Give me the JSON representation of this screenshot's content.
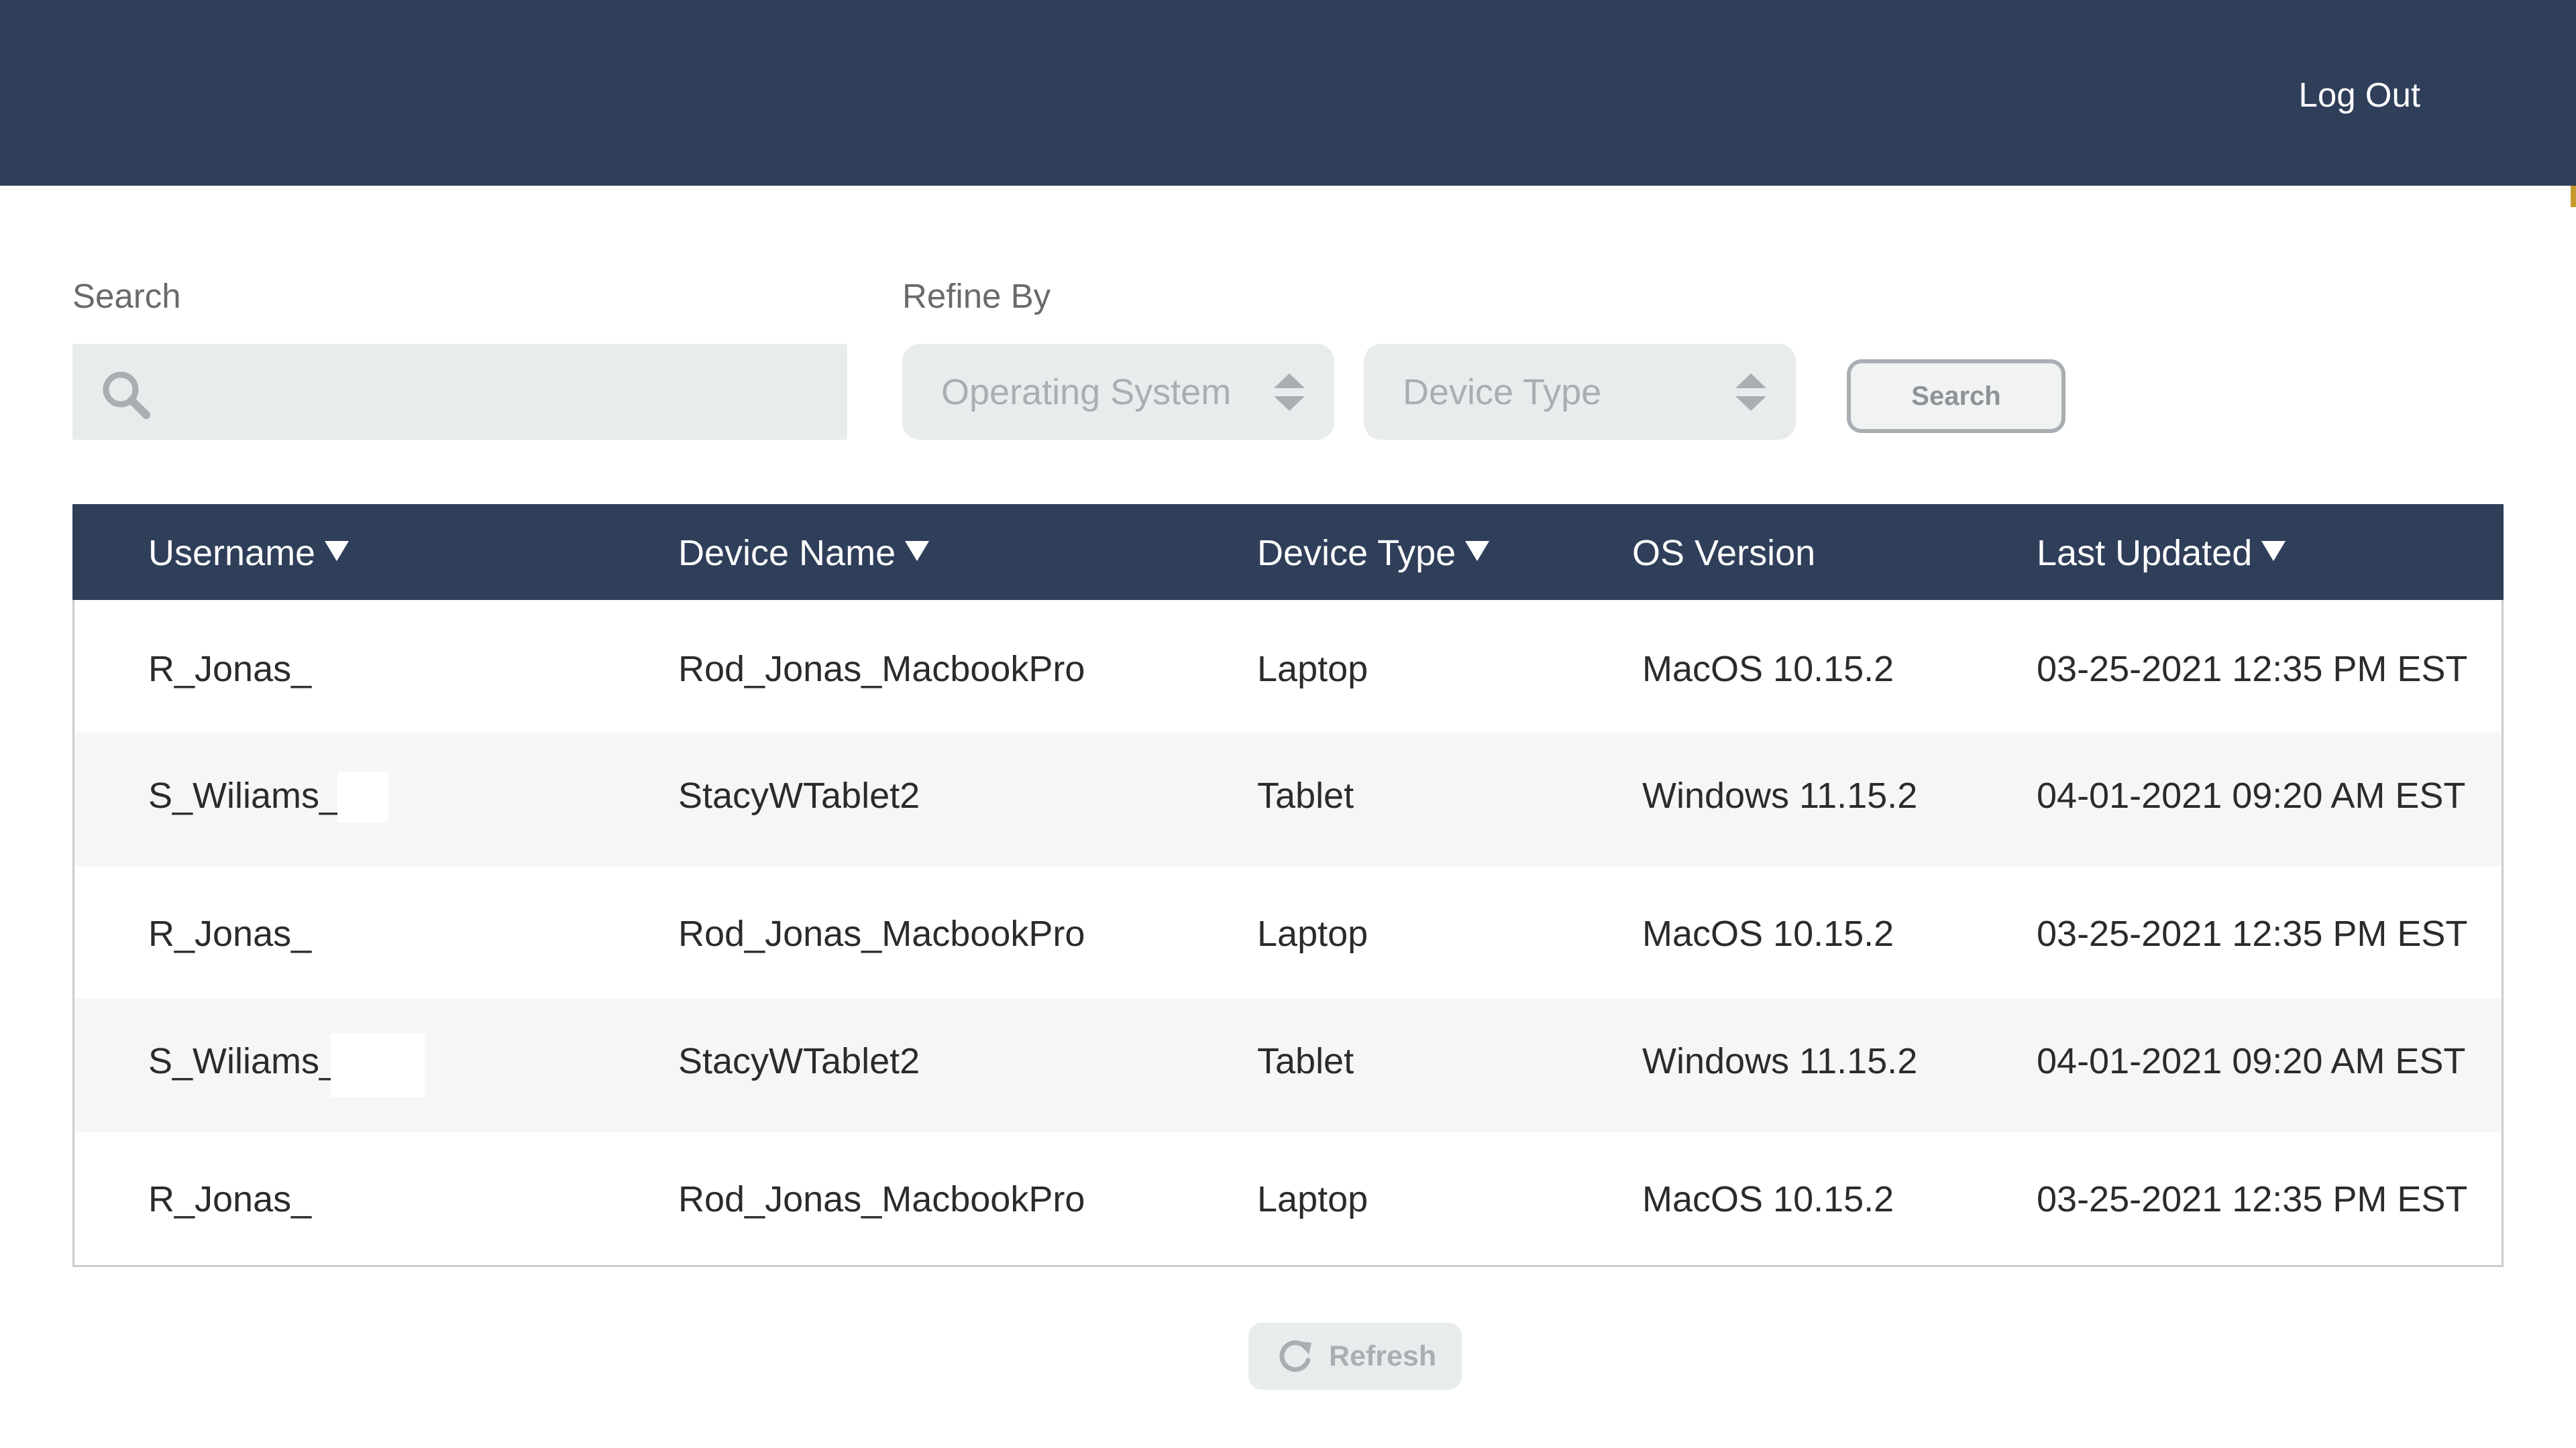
{
  "header": {
    "logout_label": "Log Out",
    "background_color": "#2f3e59"
  },
  "search": {
    "label": "Search",
    "value": "",
    "placeholder": "",
    "icon": "search-icon"
  },
  "refine": {
    "label": "Refine By",
    "os_select": {
      "selected": "Operating System",
      "icon": "sort-arrows-icon"
    },
    "device_select": {
      "selected": "Device Type",
      "icon": "sort-arrows-icon"
    }
  },
  "search_button_label": "Search",
  "table": {
    "columns": [
      {
        "label": "Username",
        "sortable": true
      },
      {
        "label": "Device Name",
        "sortable": true
      },
      {
        "label": "Device Type",
        "sortable": true
      },
      {
        "label": "OS Version",
        "sortable": false
      },
      {
        "label": "Last Updated",
        "sortable": true
      }
    ],
    "rows": [
      [
        "R_Jonas_",
        "Rod_Jonas_MacbookPro",
        "Laptop",
        "MacOS 10.15.2",
        "03-25-2021 12:35 PM EST"
      ],
      [
        "S_Wiliams_\\",
        "StacyWTablet2",
        "Tablet",
        "Windows 11.15.2",
        "04-01-2021 09:20 AM EST"
      ],
      [
        "R_Jonas_",
        "Rod_Jonas_MacbookPro",
        "Laptop",
        "MacOS 10.15.2",
        "03-25-2021 12:35 PM EST"
      ],
      [
        "S_Wiliams_",
        "StacyWTablet2",
        "Tablet",
        "Windows 11.15.2",
        "04-01-2021 09:20 AM EST"
      ],
      [
        "R_Jonas_",
        "Rod_Jonas_MacbookPro",
        "Laptop",
        "MacOS 10.15.2",
        "03-25-2021 12:35 PM EST"
      ]
    ]
  },
  "refresh_button": {
    "label": "Refresh",
    "icon": "refresh-icon"
  },
  "colors": {
    "navy": "#2f3e59",
    "field_bg": "#e9ecec",
    "muted_text": "#a9aeb2",
    "accent": "#c89a2e"
  }
}
